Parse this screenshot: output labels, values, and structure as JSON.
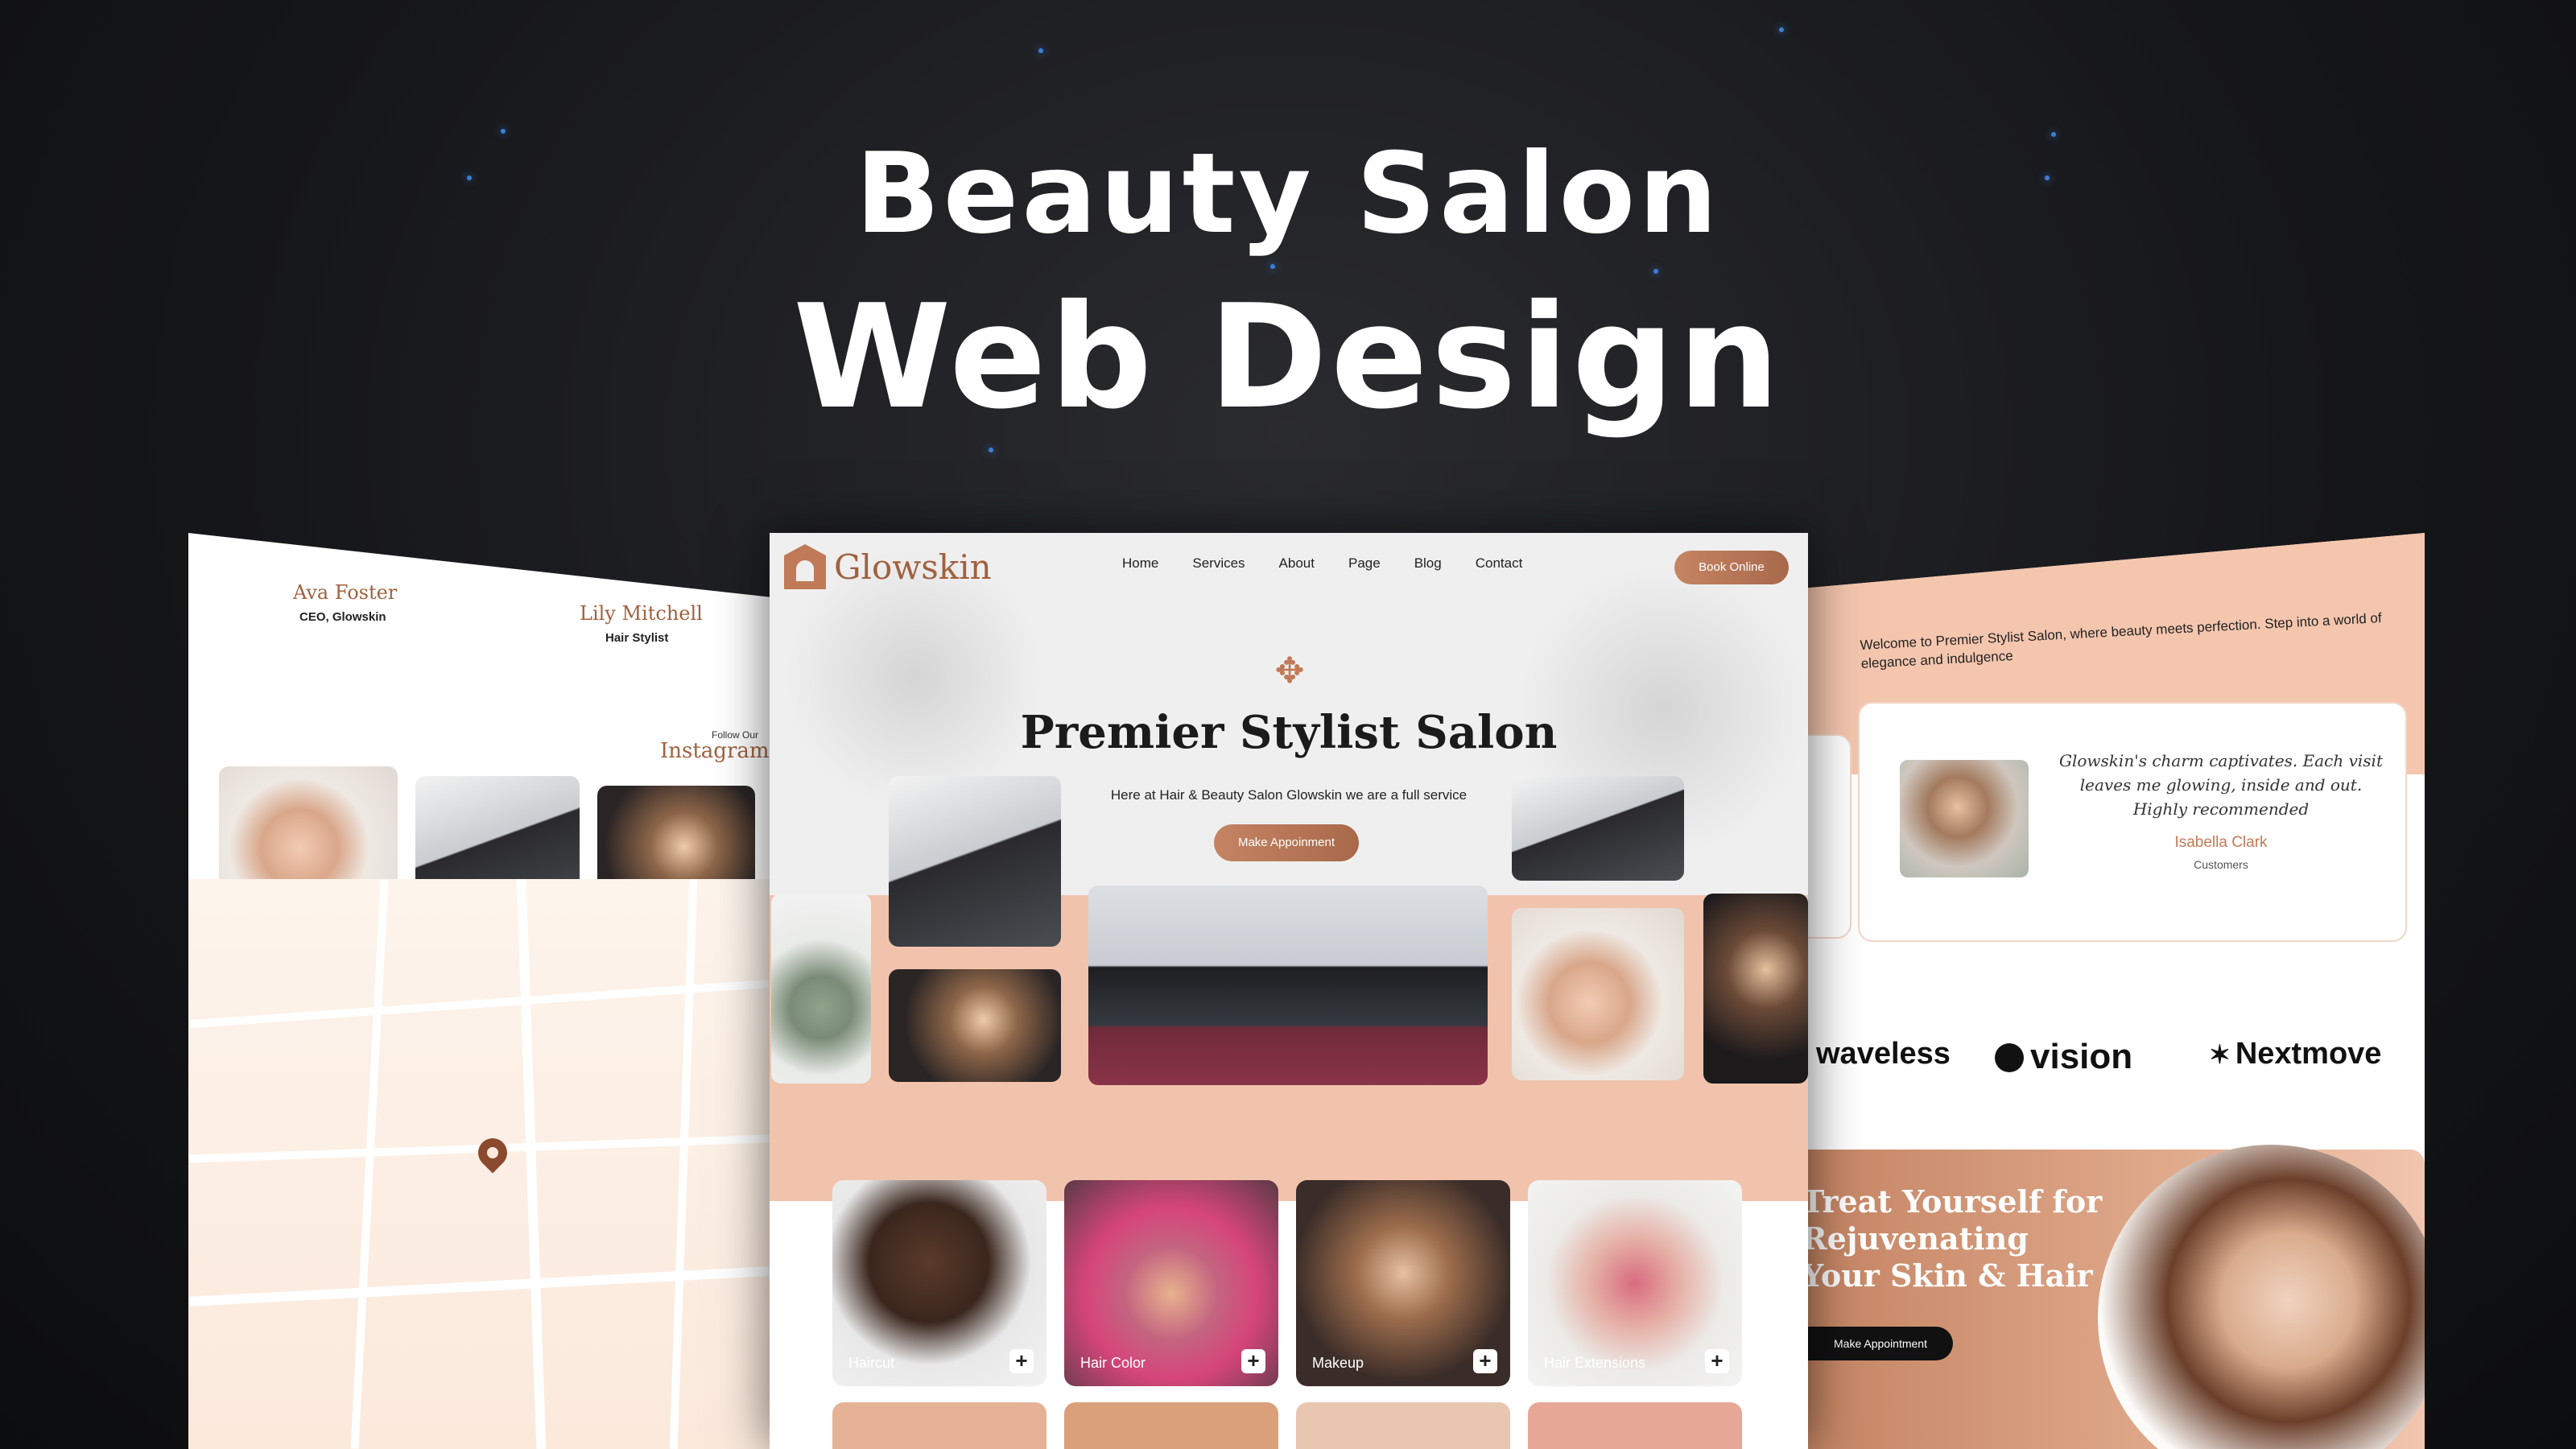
{
  "headline": {
    "line1": "Beauty Salon",
    "line2": "Web Design"
  },
  "center": {
    "logo": "Glowskin",
    "menu": [
      "Home",
      "Services",
      "About",
      "Page",
      "Blog",
      "Contact"
    ],
    "book_btn": "Book Online",
    "hero_title": "Premier Stylist Salon",
    "hero_sub": "Here at Hair & Beauty Salon Glowskin we are a full service",
    "hero_btn": "Make Appoinment",
    "services": [
      "Haircut",
      "Hair Color",
      "Makeup",
      "Hair Extensions"
    ]
  },
  "left": {
    "team": [
      {
        "name": "Ava Foster",
        "role": "CEO, Glowskin"
      },
      {
        "name": "Lily Mitchell",
        "role": "Hair Stylist"
      }
    ],
    "follow": "Follow Our",
    "instagram": "Instagram"
  },
  "right": {
    "welcome": "Welcome to Premier Stylist Salon, where beauty meets perfection. Step into a world of elegance and indulgence",
    "quote": "Glowskin's charm captivates. Each visit leaves me glowing, inside and out. Highly recommended",
    "author": "Isabella Clark",
    "author_role": "Customers",
    "brands": [
      "waveless",
      "vision",
      "Nextmove"
    ],
    "cta_title": "Treat Yourself for Rejuvenating Your Skin & Hair",
    "cta_btn": "Make Appointment"
  },
  "colors": {
    "accent": "#c17a57",
    "peach": "#f1c3ac",
    "background": "#16171a",
    "star": "#3b7fd6"
  }
}
